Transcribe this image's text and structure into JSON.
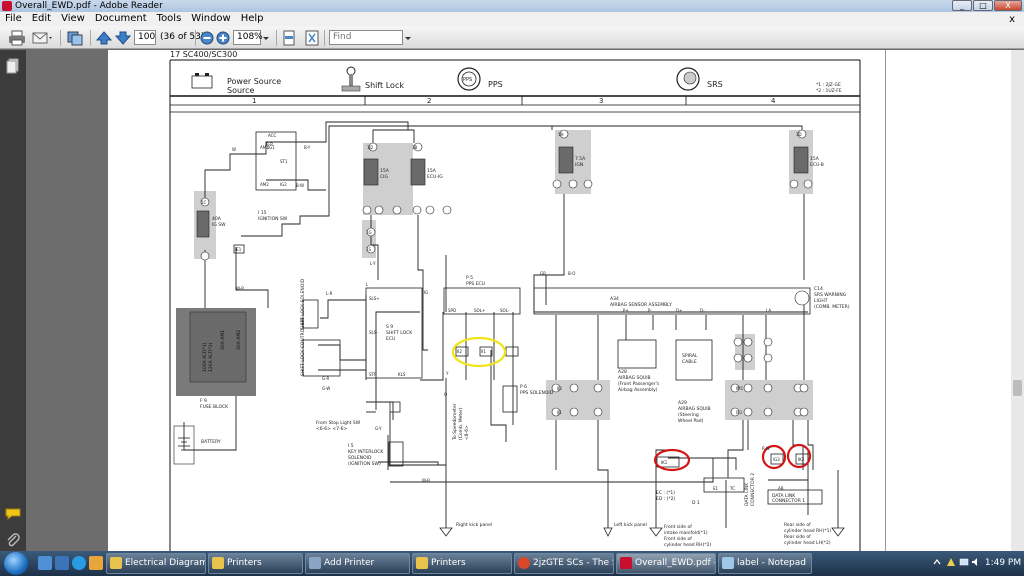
{
  "window": {
    "title": "Overall_EWD.pdf - Adobe Reader",
    "minimize": "_",
    "maximize": "□",
    "close": "X"
  },
  "menu": {
    "items": [
      "File",
      "Edit",
      "View",
      "Document",
      "Tools",
      "Window",
      "Help"
    ],
    "close": "x"
  },
  "toolbar": {
    "page_number": "100",
    "page_of": "(36 of 53)",
    "zoom": "108%",
    "find_placeholder": "Find",
    "icons": [
      "print-icon",
      "email-icon",
      "share-icon",
      "page-up-icon",
      "page-down-icon",
      "zoom-out-icon",
      "zoom-in-icon",
      "single-page-icon",
      "fit-page-icon"
    ]
  },
  "diagram": {
    "header": "17 SC400/SC300",
    "systems": [
      "Power Source",
      "Shift Lock",
      "PPS",
      "SRS"
    ],
    "columns": [
      "1",
      "2",
      "3",
      "4"
    ],
    "engine_note": [
      "*1 : 2JZ-GE",
      "*2 : 1UZ-FE"
    ],
    "components": {
      "ignition_sw": [
        "I 15",
        "IGNITION SW"
      ],
      "fuse_ig_sw": [
        "40A",
        "IG SW"
      ],
      "fuse_cig": [
        "15A",
        "CIG"
      ],
      "fuse_ecu_ig": [
        "15A",
        "ECU-IG"
      ],
      "fuse_ign": [
        "7.5A",
        "IGN"
      ],
      "fuse_ecu_b": [
        "15A",
        "ECU-B"
      ],
      "fuse_block": [
        "F 9",
        "FUSE BLOCK"
      ],
      "battery": "BATTERY",
      "shift_lock_ecu": [
        "S 9",
        "SHIFT LOCK",
        "ECU"
      ],
      "pps_ecu": [
        "P 5",
        "PPS ECU"
      ],
      "pps_solenoid": [
        "P 6",
        "PPS SOLENOID"
      ],
      "airbag_sensor": [
        "A34",
        "AIRBAG SENSOR ASSEMBLY"
      ],
      "airbag_squib_front": [
        "A28",
        "AIRBAG SQUIB",
        "(Front Passenger's",
        "Airbag Assembly)"
      ],
      "airbag_squib_steering": [
        "A29",
        "AIRBAG SQUIB",
        "(Steering",
        "Wheel Pad)"
      ],
      "spiral_cable": [
        "SPIRAL",
        "CABLE"
      ],
      "srs_warning": [
        "C14",
        "SRS WARNING",
        "LIGHT",
        "(COMB. METER)"
      ],
      "key_interlock": [
        "I 5",
        "KEY INTERLOCK",
        "SOLENOID",
        "(IGNITION SW)"
      ],
      "stop_light": [
        "From Stop Light SW",
        "<6-6> <7-6>"
      ],
      "speedometer": [
        "To Speedometer",
        "(Comb. Meter)",
        "<8-6>"
      ],
      "shift_lock_solenoid": "SHIFT LOCK SOLENOID",
      "shift_lock_control_sw": "SHIFT LOCK CONTROL SW",
      "data_link_1": [
        "D 1",
        "DATA LINK",
        "CONNECTOR 1"
      ],
      "data_link_2": [
        "D 2",
        "DATA LINK",
        "CONNECTOR 2"
      ],
      "alt_fuses": [
        "100A ALT(*1)",
        "120A ALT(*2)",
        "30A AM1",
        "30A AM2"
      ]
    },
    "grounds": {
      "ec": [
        "EC : (*1)",
        "ED : (*2)"
      ],
      "front_intake": [
        "Front side of",
        "intake manifold(*1)",
        "Front side of",
        "cylinder head RH(*2)"
      ],
      "rear_cyl": [
        "Rear side of",
        "cylinder head RH(*1)",
        "Rear side of",
        "cylinder head LH(*2)"
      ],
      "right_kick": "Right kick panel",
      "left_kick": "Left kick panel"
    },
    "wires": [
      "W",
      "B-W",
      "B-Y",
      "W-B",
      "B-R",
      "W-R",
      "G-R",
      "G-W",
      "L-R",
      "L-Y",
      "G-Y",
      "B-O",
      "R-W",
      "Y",
      "O",
      "GR",
      "L"
    ],
    "pins": [
      "ACC",
      "IG1",
      "IG2",
      "AM1",
      "AM2",
      "ST1",
      "SLS+",
      "SLS-",
      "KLS",
      "STP",
      "SPD",
      "SOL+",
      "SOL-",
      "IG",
      "E1",
      "TC",
      "AB",
      "LA",
      "P+",
      "P-",
      "D+",
      "D-"
    ],
    "connectors": [
      "1J2",
      "1B",
      "1G",
      "1S",
      "1H",
      "1D",
      "1C",
      "II2",
      "II1",
      "IE1",
      "IK1",
      "IK2",
      "IG3",
      "IJ2",
      "IJ1",
      "IM1",
      "IS1"
    ]
  },
  "taskbar": {
    "tasks": [
      "Electrical Diagrams",
      "Printers",
      "Add Printer",
      "Printers",
      "2jzGTE SCs - The Sib...",
      "Overall_EWD.pdf - A...",
      "label - Notepad"
    ],
    "clock": "1:49 PM"
  }
}
